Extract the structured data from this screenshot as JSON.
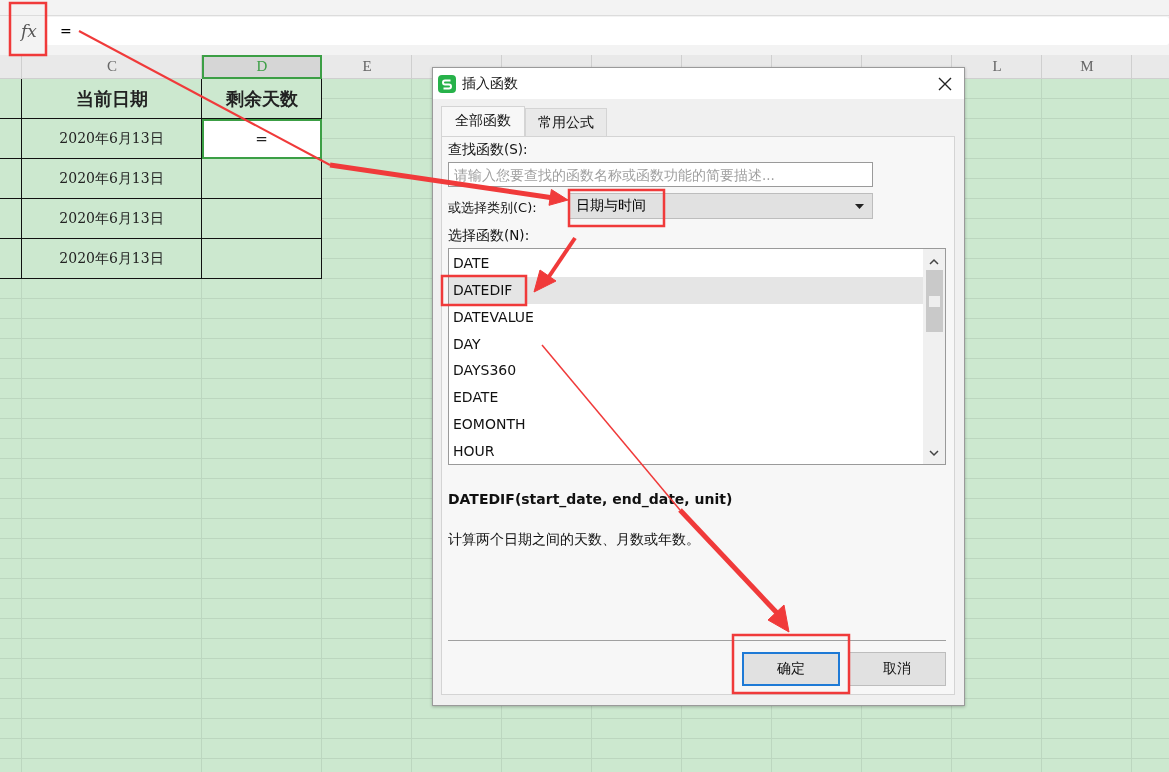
{
  "formula_bar": {
    "fx_label": "fx",
    "value": "="
  },
  "sheet": {
    "columns": [
      {
        "label": "C",
        "selected": false
      },
      {
        "label": "D",
        "selected": true
      },
      {
        "label": "E",
        "selected": false
      },
      {
        "label": "L",
        "selected": false
      },
      {
        "label": "M",
        "selected": false
      }
    ],
    "header": [
      "当前日期",
      "剩余天数"
    ],
    "rows": [
      {
        "date": "2020年6月13日",
        "value": "=",
        "selected": true
      },
      {
        "date": "2020年6月13日",
        "selected": false
      },
      {
        "date": "2020年6月13日",
        "selected": false
      },
      {
        "date": "2020年6月13日",
        "selected": false
      }
    ]
  },
  "dialog": {
    "title": "插入函数",
    "tabs": [
      {
        "label": "全部函数",
        "selected": true
      },
      {
        "label": "常用公式",
        "selected": false
      }
    ],
    "search_label": "查找函数(S):",
    "search_placeholder": "请输入您要查找的函数名称或函数功能的简要描述...",
    "category_label": "或选择类别(C):",
    "category": "日期与时间",
    "list_label": "选择函数(N):",
    "functions": [
      {
        "name": "DATE",
        "selected": false
      },
      {
        "name": "DATEDIF",
        "selected": true
      },
      {
        "name": "DATEVALUE",
        "selected": false
      },
      {
        "name": "DAY",
        "selected": false
      },
      {
        "name": "DAYS360",
        "selected": false
      },
      {
        "name": "EDATE",
        "selected": false
      },
      {
        "name": "EOMONTH",
        "selected": false
      },
      {
        "name": "HOUR",
        "selected": false
      }
    ],
    "signature": "DATEDIF(start_date, end_date, unit)",
    "description": "计算两个日期之间的天数、月数或年数。",
    "buttons": [
      {
        "label": "确定",
        "default": true
      },
      {
        "label": "取消",
        "default": false
      }
    ]
  }
}
